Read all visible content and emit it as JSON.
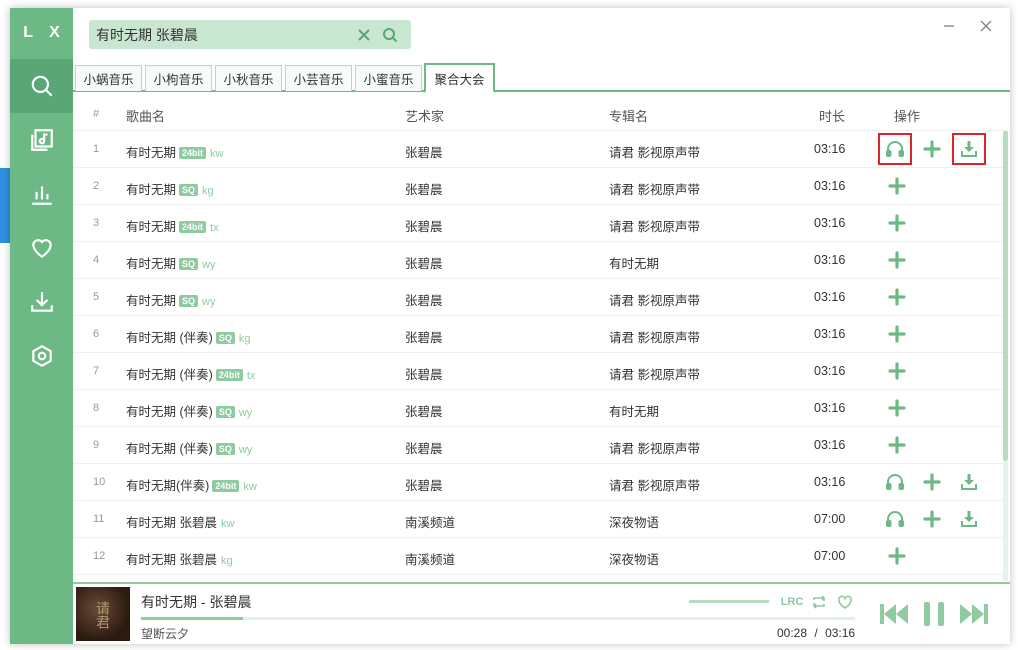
{
  "app": {
    "logo": "L X",
    "accent": "#6cb985"
  },
  "sidebar": {
    "items": [
      {
        "name": "search",
        "icon": "search-icon"
      },
      {
        "name": "songlist",
        "icon": "music-list-icon"
      },
      {
        "name": "leaderboard",
        "icon": "chart-icon"
      },
      {
        "name": "favorites",
        "icon": "heart-icon"
      },
      {
        "name": "download",
        "icon": "download-icon"
      },
      {
        "name": "settings",
        "icon": "settings-icon"
      }
    ]
  },
  "search": {
    "value": "有时无期 张碧晨",
    "placeholder": ""
  },
  "tabs": [
    {
      "label": "小蜗音乐"
    },
    {
      "label": "小枸音乐"
    },
    {
      "label": "小秋音乐"
    },
    {
      "label": "小芸音乐"
    },
    {
      "label": "小蜜音乐"
    },
    {
      "label": "聚合大会"
    }
  ],
  "table": {
    "headers": {
      "num": "#",
      "name": "歌曲名",
      "artist": "艺术家",
      "album": "专辑名",
      "duration": "时长",
      "ops": "操作"
    },
    "rows": [
      {
        "num": "1",
        "name": "有时无期",
        "badge": "24bit",
        "src": "kw",
        "artist": "张碧晨",
        "album": "请君 影视原声带",
        "duration": "03:16",
        "full": true
      },
      {
        "num": "2",
        "name": "有时无期",
        "badge": "SQ",
        "src": "kg",
        "artist": "张碧晨",
        "album": "请君 影视原声带",
        "duration": "03:16",
        "full": false
      },
      {
        "num": "3",
        "name": "有时无期",
        "badge": "24bit",
        "src": "tx",
        "artist": "张碧晨",
        "album": "请君 影视原声带",
        "duration": "03:16",
        "full": false
      },
      {
        "num": "4",
        "name": "有时无期",
        "badge": "SQ",
        "src": "wy",
        "artist": "张碧晨",
        "album": "有时无期",
        "duration": "03:16",
        "full": false
      },
      {
        "num": "5",
        "name": "有时无期",
        "badge": "SQ",
        "src": "wy",
        "artist": "张碧晨",
        "album": "请君 影视原声带",
        "duration": "03:16",
        "full": false
      },
      {
        "num": "6",
        "name": "有时无期 (伴奏)",
        "badge": "SQ",
        "src": "kg",
        "artist": "张碧晨",
        "album": "请君 影视原声带",
        "duration": "03:16",
        "full": false
      },
      {
        "num": "7",
        "name": "有时无期 (伴奏)",
        "badge": "24bit",
        "src": "tx",
        "artist": "张碧晨",
        "album": "请君 影视原声带",
        "duration": "03:16",
        "full": false
      },
      {
        "num": "8",
        "name": "有时无期 (伴奏)",
        "badge": "SQ",
        "src": "wy",
        "artist": "张碧晨",
        "album": "有时无期",
        "duration": "03:16",
        "full": false
      },
      {
        "num": "9",
        "name": "有时无期 (伴奏)",
        "badge": "SQ",
        "src": "wy",
        "artist": "张碧晨",
        "album": "请君 影视原声带",
        "duration": "03:16",
        "full": false
      },
      {
        "num": "10",
        "name": "有时无期(伴奏)",
        "badge": "24bit",
        "src": "kw",
        "artist": "张碧晨",
        "album": "请君 影视原声带",
        "duration": "03:16",
        "full": true
      },
      {
        "num": "11",
        "name": "有时无期 张碧晨",
        "badge": "",
        "src": "kw",
        "artist": "南溪频道",
        "album": "深夜物语",
        "duration": "07:00",
        "full": true
      },
      {
        "num": "12",
        "name": "有时无期 张碧晨",
        "badge": "",
        "src": "kg",
        "artist": "南溪频道",
        "album": "深夜物语",
        "duration": "07:00",
        "full": false
      }
    ]
  },
  "player": {
    "title": "有时无期 - 张碧晨",
    "artist": "望断云夕",
    "current": "00:28",
    "separator": "/",
    "total": "03:16",
    "progress": 0.143,
    "lrc_label": "LRC",
    "cover_text": "请君"
  }
}
